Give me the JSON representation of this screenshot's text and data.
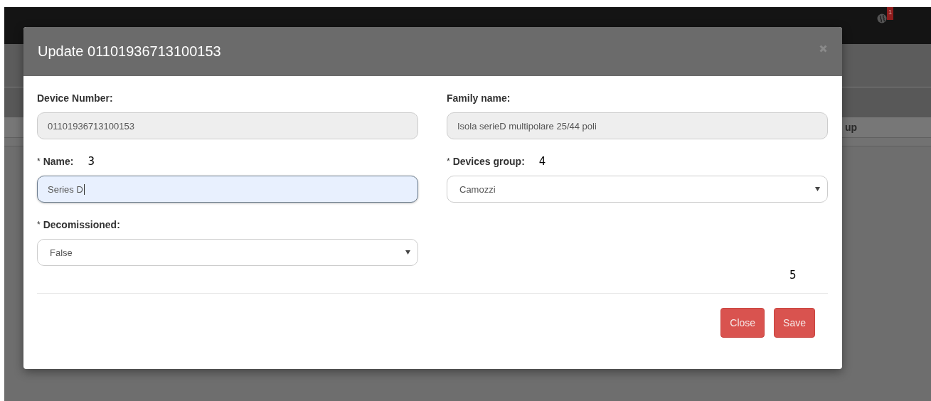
{
  "navbar": {
    "notification_count": "1"
  },
  "background_table": {
    "header_fragment": "up"
  },
  "modal": {
    "title": "Update 01101936713100153",
    "fields": [
      {
        "label": "Device Number:",
        "kind": "readonly",
        "value": "01101936713100153"
      },
      {
        "label": "Family name:",
        "kind": "readonly",
        "value": "Isola serieD multipolare 25/44 poli"
      },
      {
        "label": "Name:",
        "marker": "*",
        "kind": "text",
        "value": "Series D",
        "focused": true,
        "annotation": "3"
      },
      {
        "label": "Devices group:",
        "marker": "*",
        "kind": "select",
        "value": "Camozzi",
        "focused": false,
        "annotation": "4"
      },
      {
        "label": "Decomissioned:",
        "marker": "*",
        "kind": "select",
        "value": "False",
        "focused": false
      }
    ],
    "buttons": [
      {
        "label": "Close"
      },
      {
        "label": "Save",
        "annotation": "5"
      }
    ]
  }
}
